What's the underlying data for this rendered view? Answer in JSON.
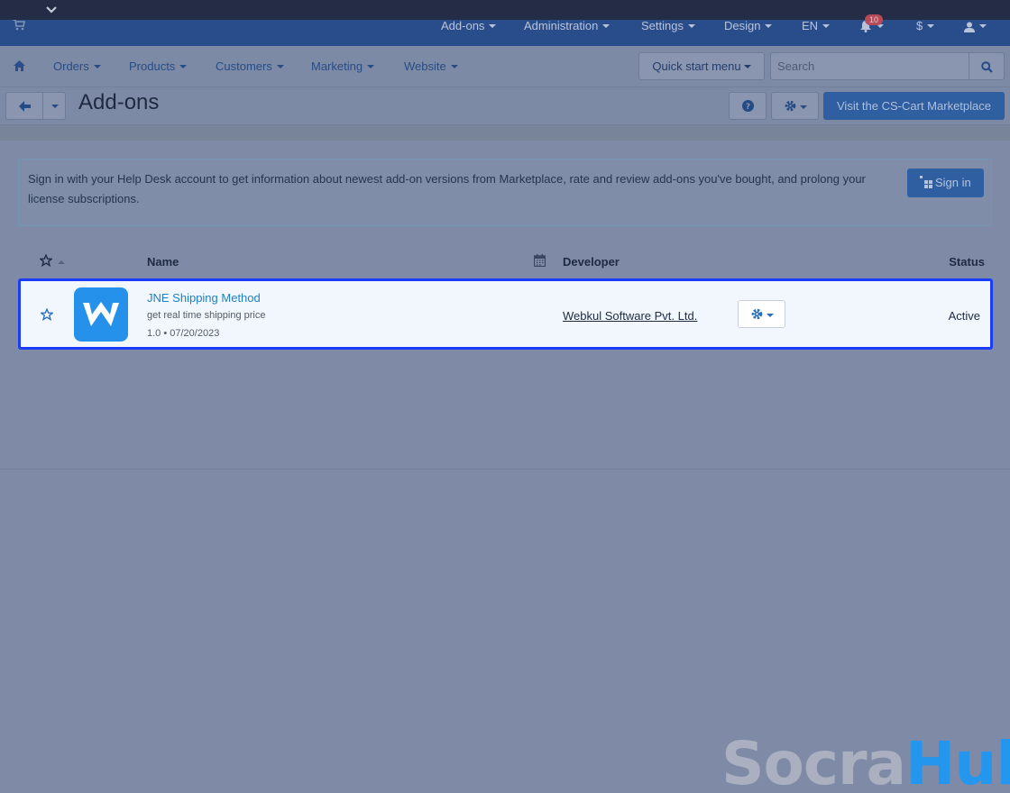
{
  "topnav": {
    "items": [
      "Add-ons",
      "Administration",
      "Settings",
      "Design",
      "EN",
      "$"
    ],
    "notifications_count": "10"
  },
  "menubar": {
    "items": [
      "Orders",
      "Products",
      "Customers",
      "Marketing",
      "Website"
    ],
    "quick_start": "Quick start menu",
    "search_placeholder": "Search"
  },
  "page": {
    "title": "Add-ons",
    "marketplace_button": "Visit the CS-Cart Marketplace"
  },
  "notice": {
    "text": "Sign in with your Help Desk account to get information about newest add-on versions from Marketplace, rate and review add-ons you've bought, and prolong your license subscriptions.",
    "signin_label": "Sign in"
  },
  "table": {
    "columns": {
      "name": "Name",
      "developer": "Developer",
      "status": "Status"
    },
    "rows": [
      {
        "name": "JNE Shipping Method",
        "description": "get real time shipping price",
        "version": "1.0 • 07/20/2023",
        "developer": "Webkul Software Pvt. Ltd.",
        "status": "Active"
      }
    ]
  },
  "watermark": {
    "part1": "Socra",
    "part2": "Hub"
  },
  "colors": {
    "accent": "#2f5fa1",
    "selection_border": "#1a3cff",
    "logo_bg": "#2591ea"
  }
}
